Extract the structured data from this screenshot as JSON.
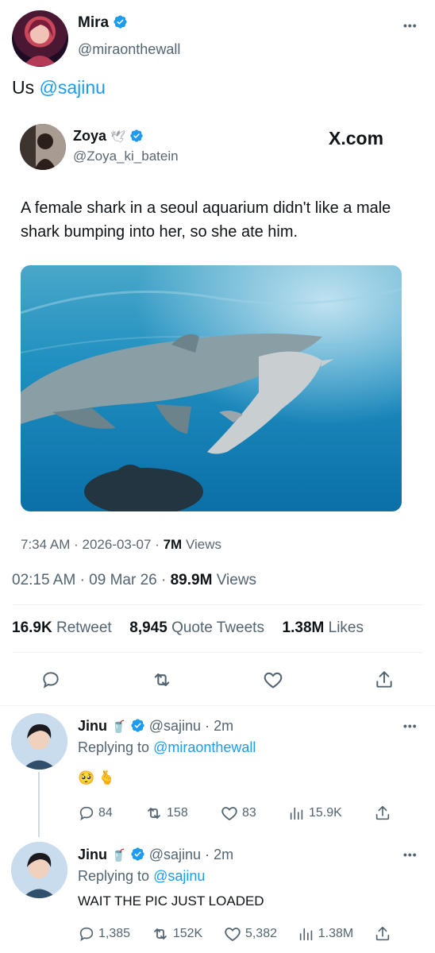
{
  "main_tweet": {
    "author_name": "Mira",
    "author_handle": "@miraonthewall",
    "text_prefix": "Us",
    "mention": "@sajinu",
    "timestamp": "02:15 AM",
    "date": "09 Mar 26",
    "views_count": "89.9M",
    "views_label": "Views",
    "stats": {
      "retweets_count": "16.9K",
      "retweets_label": "Retweet",
      "quotes_count": "8,945",
      "quotes_label": "Quote Tweets",
      "likes_count": "1.38M",
      "likes_label": "Likes"
    }
  },
  "quoted_tweet": {
    "author_name": "Zoya",
    "author_handle": "@Zoya_ki_batein",
    "watermark": "X.com",
    "text": "A female shark in a seoul aquarium didn't like a male shark bumping into her, so she ate him.",
    "time": "7:34 AM",
    "date": "2026-03-07",
    "views_count": "7M",
    "views_label": "Views"
  },
  "replies": [
    {
      "author_name": "Jinu",
      "author_handle": "@sajinu",
      "age": "2m",
      "replying_label": "Replying to",
      "replying_to": "@miraonthewall",
      "text": "🥺 🫰",
      "replies": "84",
      "retweets": "158",
      "likes": "83",
      "views": "15.9K"
    },
    {
      "author_name": "Jinu",
      "author_handle": "@sajinu",
      "age": "2m",
      "replying_label": "Replying to",
      "replying_to": "@sajinu",
      "text": "WAIT THE PIC JUST LOADED",
      "replies": "1,385",
      "retweets": "152K",
      "likes": "5,382",
      "views": "1.38M"
    }
  ],
  "colors": {
    "accent": "#1d9bf0",
    "secondary_text": "#536471",
    "divider": "#eff3f4"
  },
  "icons": [
    "verified-badge-icon",
    "more-icon",
    "reply-icon",
    "retweet-icon",
    "like-icon",
    "share-icon",
    "views-icon",
    "dove-emoji-icon",
    "drink-emoji-icon"
  ]
}
